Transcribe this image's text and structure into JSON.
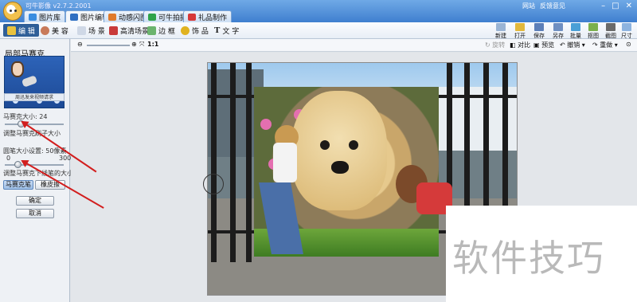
{
  "app": {
    "name": "可牛影像 v2.7.2.2001",
    "top_tabs": [
      "图片库",
      "图片编辑",
      "动感闪图",
      "可牛拍摄",
      "礼品制作"
    ],
    "links": [
      "网站",
      "反馈意见"
    ]
  },
  "modules": [
    "编 辑",
    "美 容",
    "场 景",
    "高清场景",
    "边 框",
    "饰 品",
    "文 字"
  ],
  "right_tools": [
    "新建",
    "打开",
    "保存",
    "另存",
    "批量",
    "抠图",
    "截图",
    "尺寸"
  ],
  "left_panel": {
    "title": "局部马赛克",
    "notice": "周迅发来视频请求",
    "size_label": "马赛克大小: 24",
    "size_hint": "调整马赛克刷子大小",
    "fixed_label": "圆笔大小设置: 50像素",
    "range_min": "0",
    "range_max": "300",
    "fixed_hint": "调整马赛克下线笔的大小",
    "mode_buttons": [
      "马赛克笔",
      "橡皮擦"
    ],
    "ok": "确定",
    "cancel": "取消"
  },
  "image_toolbar": {
    "ratio": "1:1",
    "items": [
      "旋转",
      "对比",
      "预览",
      "撤销",
      "重做"
    ]
  },
  "watermark": "软件技巧"
}
